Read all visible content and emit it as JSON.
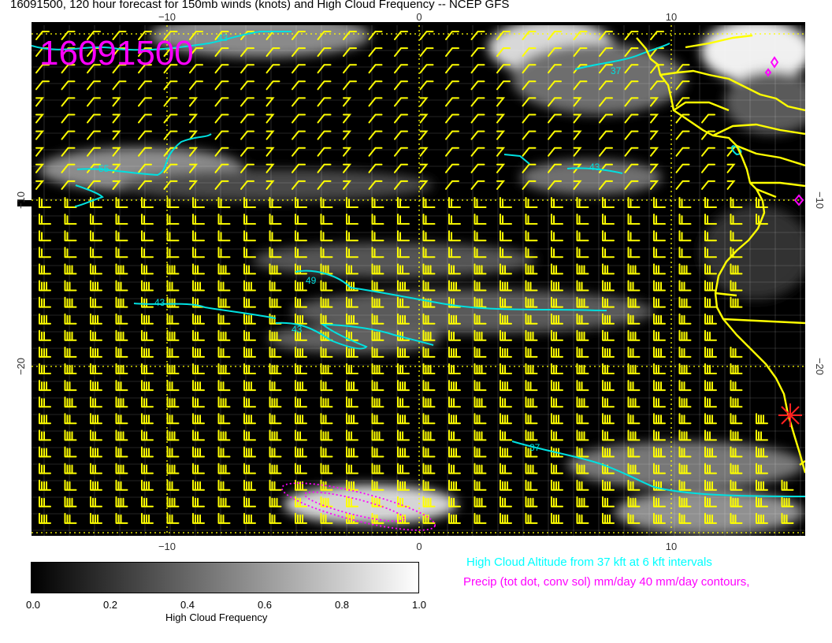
{
  "title": "16091500, 120 hour forecast for 150mb winds (knots) and High Cloud Frequency -- NCEP GFS",
  "stamp": "16091500",
  "axes": {
    "x_top_labels": [
      "−10",
      "0",
      "10"
    ],
    "x_bottom_labels": [
      "−10",
      "0",
      "10"
    ],
    "y_left_labels": [
      "−10",
      "−20"
    ],
    "y_right_labels": [
      "−10",
      "−20"
    ],
    "lon_range": [
      -16,
      15.5
    ],
    "lat_range": [
      -28.5,
      -1.5
    ]
  },
  "contours": [
    {
      "label": "43",
      "kind": "high-cloud-altitude"
    },
    {
      "label": "37",
      "kind": "high-cloud-altitude"
    },
    {
      "label": "55",
      "kind": "high-cloud-altitude"
    },
    {
      "label": "43",
      "kind": "high-cloud-altitude"
    },
    {
      "label": "49",
      "kind": "high-cloud-altitude"
    },
    {
      "label": "43",
      "kind": "high-cloud-altitude"
    },
    {
      "label": "43",
      "kind": "high-cloud-altitude"
    },
    {
      "label": "37",
      "kind": "high-cloud-altitude"
    }
  ],
  "colorbar": {
    "ticks": [
      "0.0",
      "0.2",
      "0.4",
      "0.6",
      "0.8",
      "1.0"
    ],
    "title": "High Cloud Frequency"
  },
  "legend": {
    "cloud_altitude": "High Cloud Altitude from 37 kft at 6 kft intervals",
    "precip": "Precip (tot dot, conv sol) mm/day 40 mm/day contours,"
  },
  "colors": {
    "background": "#000000",
    "barbs": "#ffff00",
    "coast": "#ffff00",
    "cloud_contour": "#00ffff",
    "precip": "#ff00ff",
    "stamp": "#ff00ff",
    "marker": "#ff0000"
  },
  "icons": {
    "station_marker": "red-asterisk-icon",
    "precip_marker": "magenta-diamond-icon"
  }
}
